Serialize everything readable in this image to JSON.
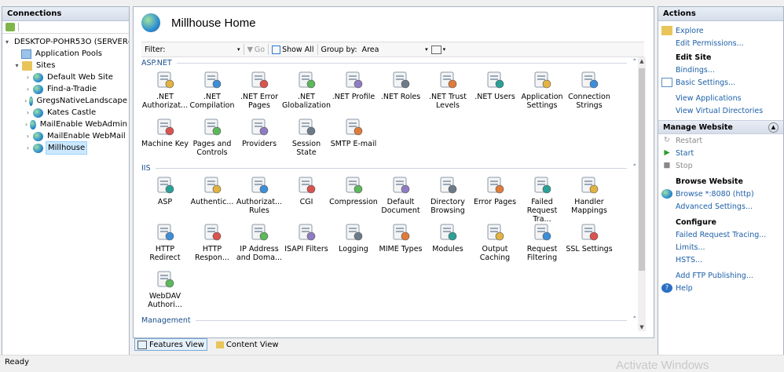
{
  "connections": {
    "title": "Connections",
    "tree": {
      "server": "DESKTOP-POHR53O (SERVER-",
      "app_pools": "Application Pools",
      "sites_label": "Sites",
      "sites": [
        "Default Web Site",
        "Find-a-Tradie",
        "GregsNativeLandscape",
        "Kates Castle",
        "MailEnable WebAdmin",
        "MailEnable WebMail",
        "Millhouse"
      ]
    }
  },
  "main": {
    "title": "Millhouse Home",
    "filter_label": "Filter:",
    "filter_value": "",
    "go_label": "Go",
    "show_all_label": "Show All",
    "group_by_label": "Group by:",
    "group_by_value": "Area",
    "sections": [
      {
        "name": "ASP.NET",
        "items": [
          ".NET Authorizat...",
          ".NET Compilation",
          ".NET Error Pages",
          ".NET Globalization",
          ".NET Profile",
          ".NET Roles",
          ".NET Trust Levels",
          ".NET Users",
          "Application Settings",
          "Connection Strings",
          "Machine Key",
          "Pages and Controls",
          "Providers",
          "Session State",
          "SMTP E-mail"
        ]
      },
      {
        "name": "IIS",
        "items": [
          "ASP",
          "Authentic...",
          "Authorizat... Rules",
          "CGI",
          "Compression",
          "Default Document",
          "Directory Browsing",
          "Error Pages",
          "Failed Request Tra...",
          "Handler Mappings",
          "HTTP Redirect",
          "HTTP Respon...",
          "IP Address and Doma...",
          "ISAPI Filters",
          "Logging",
          "MIME Types",
          "Modules",
          "Output Caching",
          "Request Filtering",
          "SSL Settings",
          "WebDAV Authori..."
        ]
      },
      {
        "name": "Management",
        "items": []
      }
    ]
  },
  "views": {
    "features": "Features View",
    "content": "Content View"
  },
  "actions": {
    "title": "Actions",
    "top": [
      "Explore",
      "Edit Permissions..."
    ],
    "edit_site_title": "Edit Site",
    "edit_site": [
      "Bindings...",
      "Basic Settings..."
    ],
    "view_links": [
      "View Applications",
      "View Virtual Directories"
    ],
    "manage_title": "Manage Website",
    "manage": [
      "Restart",
      "Start",
      "Stop"
    ],
    "browse_title": "Browse Website",
    "browse": [
      "Browse *:8080 (http)"
    ],
    "advanced": "Advanced Settings...",
    "configure_title": "Configure",
    "configure": [
      "Failed Request Tracing...",
      "Limits...",
      "HSTS..."
    ],
    "ftp": "Add FTP Publishing...",
    "help": "Help"
  },
  "status": {
    "text": "Ready",
    "watermark": "Activate Windows"
  }
}
